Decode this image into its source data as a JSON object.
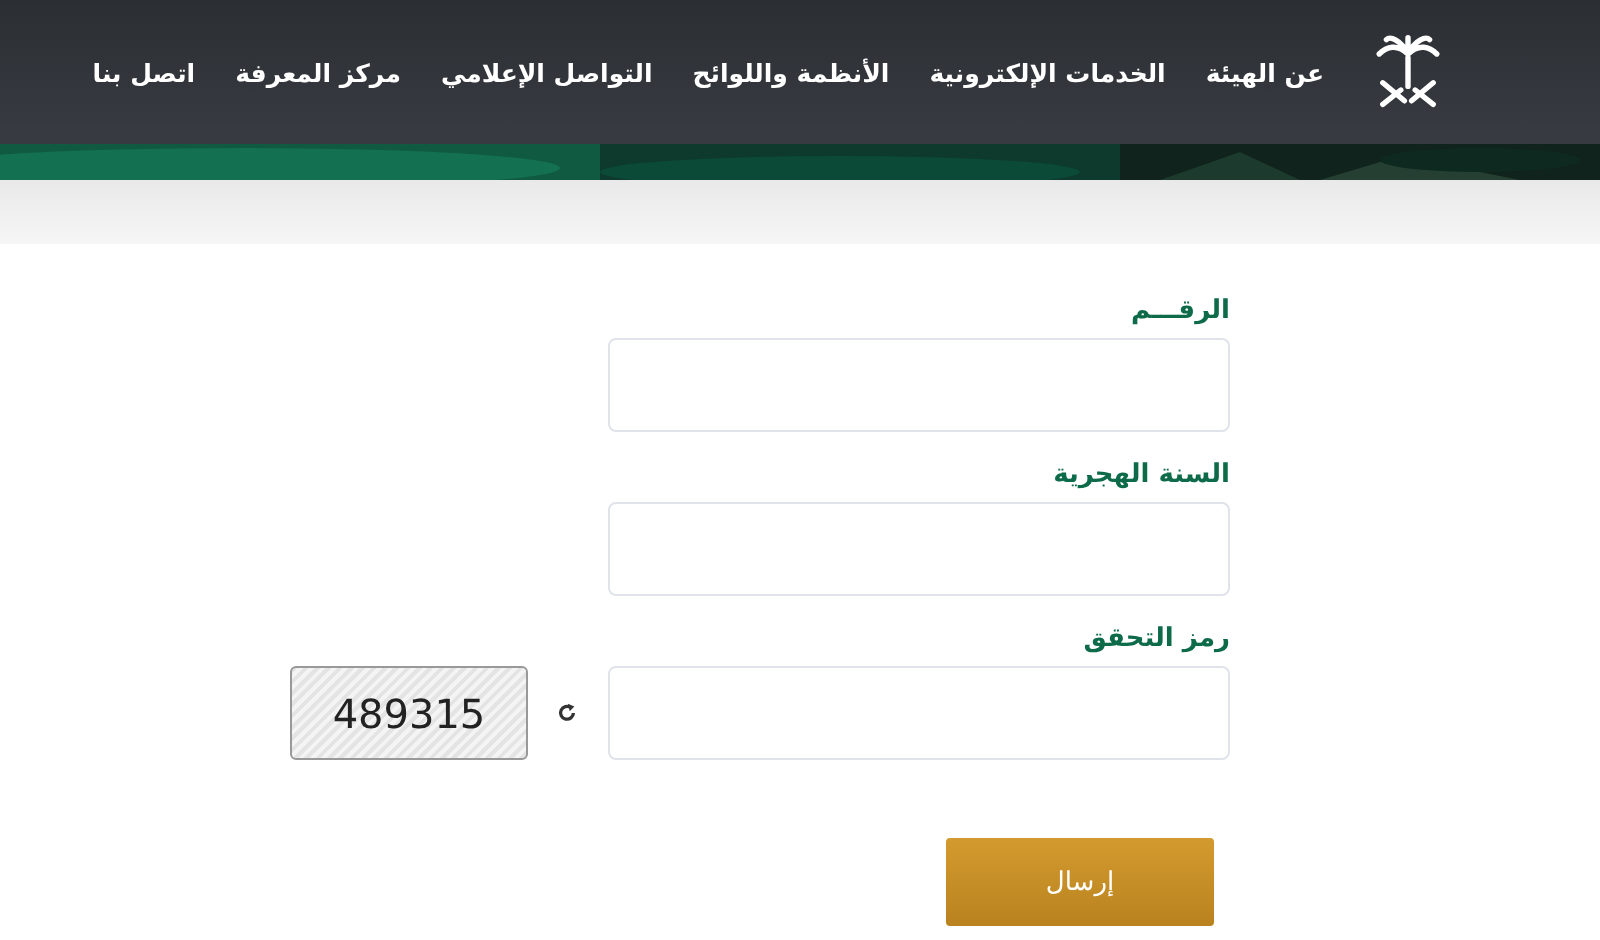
{
  "nav": {
    "items": [
      {
        "label": "عن الهيئة"
      },
      {
        "label": "الخدمات الإلكترونية"
      },
      {
        "label": "الأنظمة واللوائح"
      },
      {
        "label": "التواصل الإعلامي"
      },
      {
        "label": "مركز المعرفة"
      },
      {
        "label": "اتصل بنا"
      }
    ]
  },
  "form": {
    "fields": [
      {
        "label": "الرقـــم"
      },
      {
        "label": "السنة الهجرية"
      }
    ],
    "captcha": {
      "label": "رمز التحقق",
      "code": "489315"
    },
    "submit": "إرسال"
  }
}
